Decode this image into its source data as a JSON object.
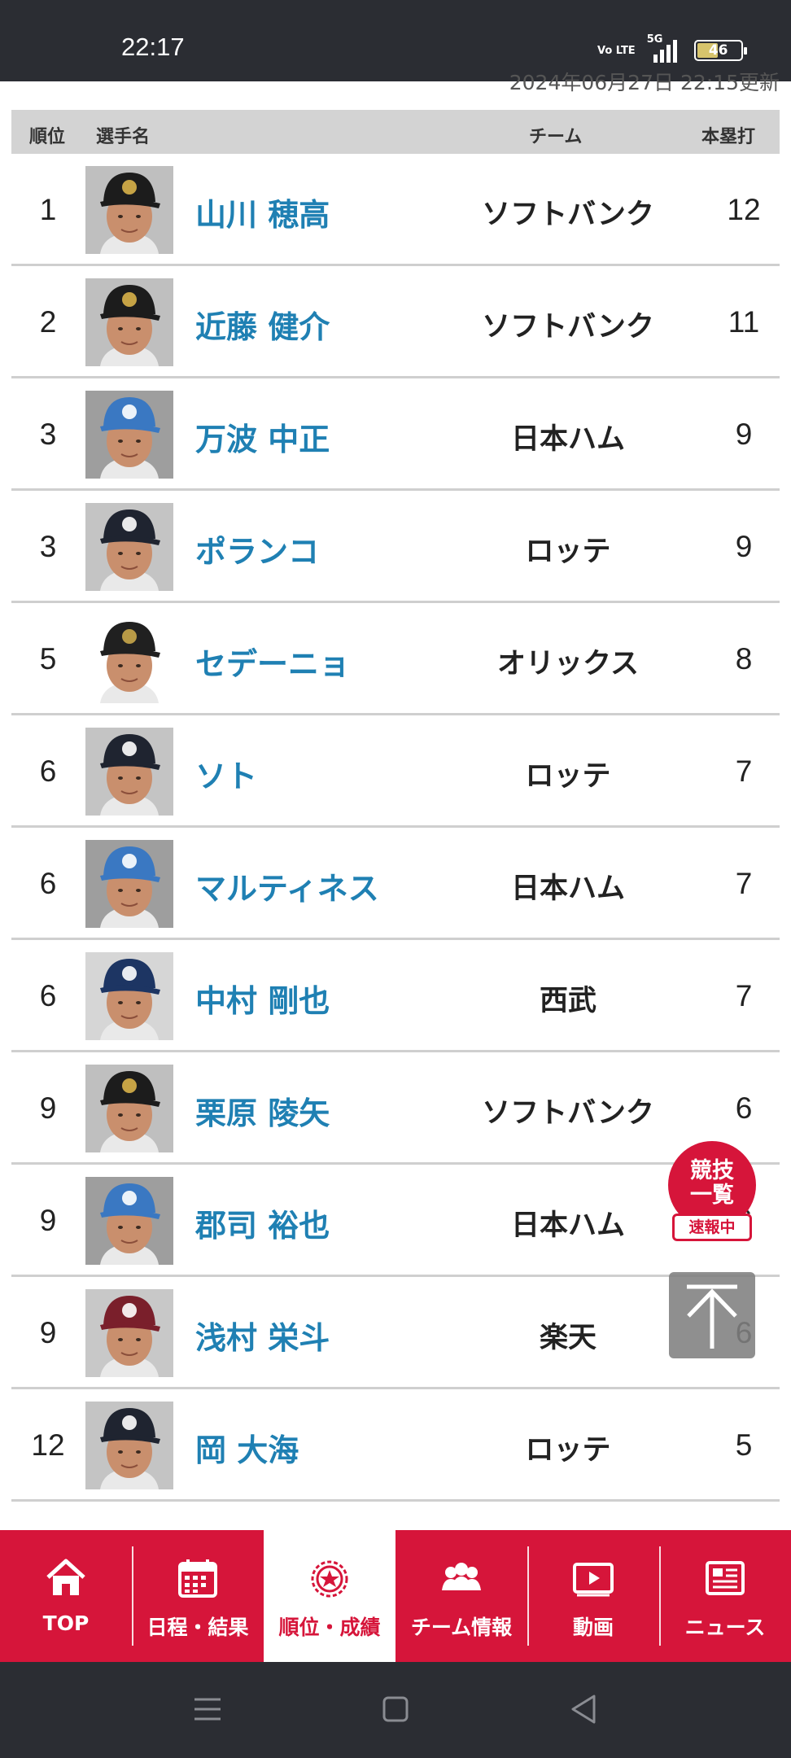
{
  "status_bar": {
    "time": "22:17",
    "volte": "Vo LTE",
    "network": "5G",
    "battery": "46"
  },
  "update_time": "2024年06月27日 22:15更新",
  "table": {
    "headers": {
      "rank": "順位",
      "player": "選手名",
      "team": "チーム",
      "stat": "本塁打"
    },
    "rows": [
      {
        "rank": "1",
        "name": "山川 穂高",
        "team": "ソフトバンク",
        "value": "12",
        "cap": "hawks"
      },
      {
        "rank": "2",
        "name": "近藤 健介",
        "team": "ソフトバンク",
        "value": "11",
        "cap": "hawks"
      },
      {
        "rank": "3",
        "name": "万波 中正",
        "team": "日本ハム",
        "value": "9",
        "cap": "fighters"
      },
      {
        "rank": "3",
        "name": "ポランコ",
        "team": "ロッテ",
        "value": "9",
        "cap": "marines"
      },
      {
        "rank": "5",
        "name": "セデーニョ",
        "team": "オリックス",
        "value": "8",
        "cap": "buffaloes"
      },
      {
        "rank": "6",
        "name": "ソト",
        "team": "ロッテ",
        "value": "7",
        "cap": "marines"
      },
      {
        "rank": "6",
        "name": "マルティネス",
        "team": "日本ハム",
        "value": "7",
        "cap": "fighters"
      },
      {
        "rank": "6",
        "name": "中村 剛也",
        "team": "西武",
        "value": "7",
        "cap": "lions"
      },
      {
        "rank": "9",
        "name": "栗原 陵矢",
        "team": "ソフトバンク",
        "value": "6",
        "cap": "hawks"
      },
      {
        "rank": "9",
        "name": "郡司 裕也",
        "team": "日本ハム",
        "value": "6",
        "cap": "fighters"
      },
      {
        "rank": "9",
        "name": "浅村 栄斗",
        "team": "楽天",
        "value": "6",
        "cap": "eagles"
      },
      {
        "rank": "12",
        "name": "岡 大海",
        "team": "ロッテ",
        "value": "5",
        "cap": "marines"
      }
    ]
  },
  "live_badge": {
    "line1": "競技",
    "line2": "一覧",
    "tag": "速報中"
  },
  "bottom_nav": {
    "items": [
      {
        "label": "TOP",
        "icon": "home-icon"
      },
      {
        "label": "日程・結果",
        "icon": "calendar-icon"
      },
      {
        "label": "順位・成績",
        "icon": "medal-icon"
      },
      {
        "label": "チーム情報",
        "icon": "team-icon"
      },
      {
        "label": "動画",
        "icon": "video-icon"
      },
      {
        "label": "ニュース",
        "icon": "news-icon"
      }
    ],
    "active_index": 2
  },
  "colors": {
    "accent": "#d6153a",
    "player_link": "#1f80b3",
    "header_bg": "#d3d3d3",
    "caps": {
      "hawks": {
        "cap": "#1c1c1c",
        "logo": "#d9b24a",
        "bg": "#bfbfbf"
      },
      "fighters": {
        "cap": "#3a78c2",
        "logo": "#ffffff",
        "bg": "#9e9e9e"
      },
      "marines": {
        "cap": "#1f2430",
        "logo": "#ffffff",
        "bg": "#c4c4c4"
      },
      "buffaloes": {
        "cap": "#202020",
        "logo": "#c9a74a",
        "bg": "#ffffff"
      },
      "lions": {
        "cap": "#1d3563",
        "logo": "#ffffff",
        "bg": "#d6d6d6"
      },
      "eagles": {
        "cap": "#7a1f2b",
        "logo": "#ffffff",
        "bg": "#c8c8c8"
      }
    }
  }
}
